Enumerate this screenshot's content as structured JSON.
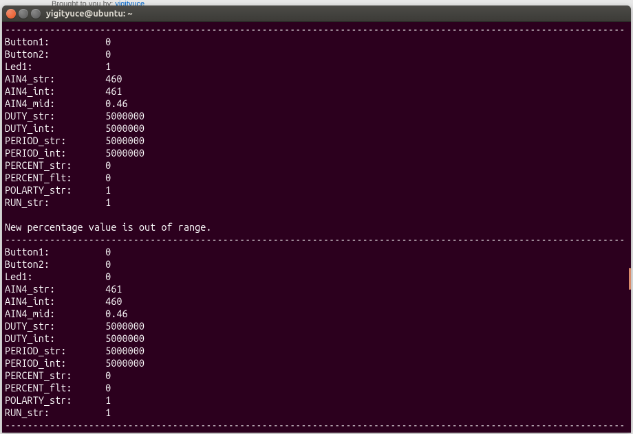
{
  "background": {
    "broughtText": "Brought to you by: ",
    "linkText": "yigityuce"
  },
  "window": {
    "title": "yigityuce@ubuntu: ~"
  },
  "terminal": {
    "separator": "---------------------------------------------------------------------------------------------------------------",
    "block1": [
      {
        "label": "Button1:",
        "value": "0"
      },
      {
        "label": "Button2:",
        "value": "0"
      },
      {
        "label": "Led1:",
        "value": "1"
      },
      {
        "label": "AIN4_str:",
        "value": "460"
      },
      {
        "label": "AIN4_int:",
        "value": "461"
      },
      {
        "label": "AIN4_mid:",
        "value": "0.46"
      },
      {
        "label": "DUTY_str:",
        "value": "5000000"
      },
      {
        "label": "DUTY_int:",
        "value": "5000000"
      },
      {
        "label": "PERIOD_str:",
        "value": "5000000"
      },
      {
        "label": "PERIOD_int:",
        "value": "5000000"
      },
      {
        "label": "PERCENT_str:",
        "value": "0"
      },
      {
        "label": "PERCENT_flt:",
        "value": "0"
      },
      {
        "label": "POLARTY_str:",
        "value": "1"
      },
      {
        "label": "RUN_str:",
        "value": "1"
      }
    ],
    "message": "New percentage value is out of range.",
    "block2": [
      {
        "label": "Button1:",
        "value": "0"
      },
      {
        "label": "Button2:",
        "value": "0"
      },
      {
        "label": "Led1:",
        "value": "0"
      },
      {
        "label": "AIN4_str:",
        "value": "461"
      },
      {
        "label": "AIN4_int:",
        "value": "460"
      },
      {
        "label": "AIN4_mid:",
        "value": "0.46"
      },
      {
        "label": "DUTY_str:",
        "value": "5000000"
      },
      {
        "label": "DUTY_int:",
        "value": "5000000"
      },
      {
        "label": "PERIOD_str:",
        "value": "5000000"
      },
      {
        "label": "PERIOD_int:",
        "value": "5000000"
      },
      {
        "label": "PERCENT_str:",
        "value": "0"
      },
      {
        "label": "PERCENT_flt:",
        "value": "0"
      },
      {
        "label": "POLARTY_str:",
        "value": "1"
      },
      {
        "label": "RUN_str:",
        "value": "1"
      }
    ]
  }
}
